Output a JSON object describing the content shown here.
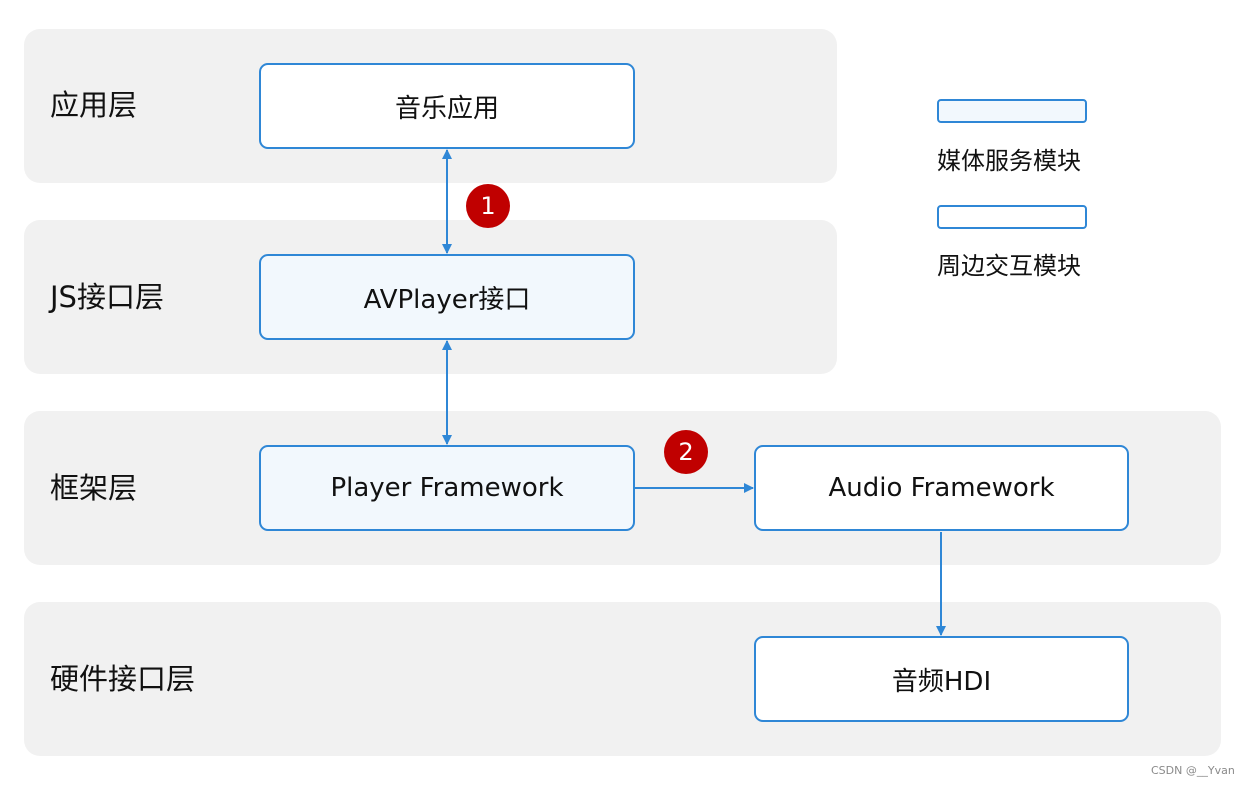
{
  "colors": {
    "layer_bg": "#f1f1f1",
    "box_border": "#2f87d6",
    "service_fill": "#f2f8fd",
    "peripheral_fill": "#ffffff",
    "badge": "#c00000",
    "arrow": "#2f87d6"
  },
  "layers": [
    {
      "id": "app",
      "label": "应用层"
    },
    {
      "id": "js",
      "label": "JS接口层"
    },
    {
      "id": "framework",
      "label": "框架层"
    },
    {
      "id": "hardware",
      "label": "硬件接口层"
    }
  ],
  "modules": [
    {
      "id": "music_app",
      "label": "音乐应用",
      "type": "peripheral",
      "layer": "app"
    },
    {
      "id": "avplayer",
      "label": "AVPlayer接口",
      "type": "service",
      "layer": "js"
    },
    {
      "id": "player_fw",
      "label": "Player Framework",
      "type": "service",
      "layer": "framework"
    },
    {
      "id": "audio_fw",
      "label": "Audio Framework",
      "type": "peripheral",
      "layer": "framework"
    },
    {
      "id": "audio_hdi",
      "label": "音频HDI",
      "type": "peripheral",
      "layer": "hardware"
    }
  ],
  "connections": [
    {
      "from": "music_app",
      "to": "avplayer",
      "direction": "bidirectional"
    },
    {
      "from": "avplayer",
      "to": "player_fw",
      "direction": "bidirectional"
    },
    {
      "from": "player_fw",
      "to": "audio_fw",
      "direction": "forward"
    },
    {
      "from": "audio_fw",
      "to": "audio_hdi",
      "direction": "forward"
    }
  ],
  "badges": [
    {
      "label": "1",
      "connection": "music_app-avplayer"
    },
    {
      "label": "2",
      "connection": "player_fw-audio_fw"
    }
  ],
  "legend": [
    {
      "type": "service",
      "label": "媒体服务模块"
    },
    {
      "type": "peripheral",
      "label": "周边交互模块"
    }
  ],
  "watermark": "CSDN @__Yvan"
}
